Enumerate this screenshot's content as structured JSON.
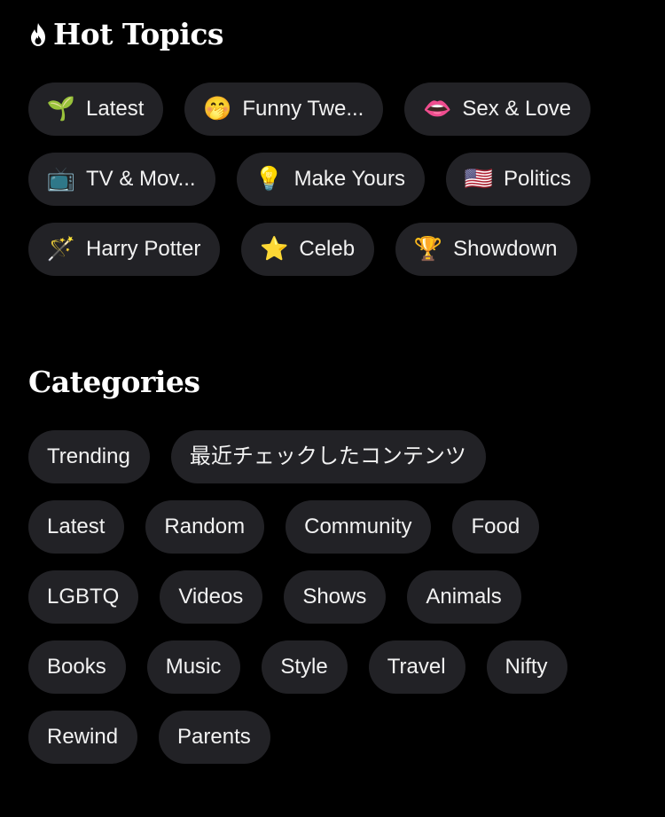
{
  "hot_topics": {
    "title": "Hot Topics",
    "rows": [
      [
        {
          "emoji": "🌱",
          "label": "Latest"
        },
        {
          "emoji": "🤭",
          "label": "Funny Twe..."
        },
        {
          "emoji": "👄",
          "label": "Sex & Love"
        }
      ],
      [
        {
          "emoji": "📺",
          "label": "TV & Mov..."
        },
        {
          "emoji": "💡",
          "label": "Make Yours"
        },
        {
          "emoji": "🇺🇸",
          "label": "Politics"
        }
      ],
      [
        {
          "emoji": "🪄",
          "label": "Harry Potter"
        },
        {
          "emoji": "⭐",
          "label": "Celeb"
        },
        {
          "emoji": "🏆",
          "label": "Showdown"
        }
      ]
    ]
  },
  "categories": {
    "title": "Categories",
    "rows": [
      [
        "Trending",
        "最近チェックしたコンテンツ"
      ],
      [
        "Latest",
        "Random",
        "Community",
        "Food"
      ],
      [
        "LGBTQ",
        "Videos",
        "Shows",
        "Animals"
      ],
      [
        "Books",
        "Music",
        "Style",
        "Travel",
        "Nifty"
      ],
      [
        "Rewind",
        "Parents"
      ]
    ]
  },
  "colors": {
    "background": "#000000",
    "pill": "#222226",
    "text": "#ffffff"
  }
}
